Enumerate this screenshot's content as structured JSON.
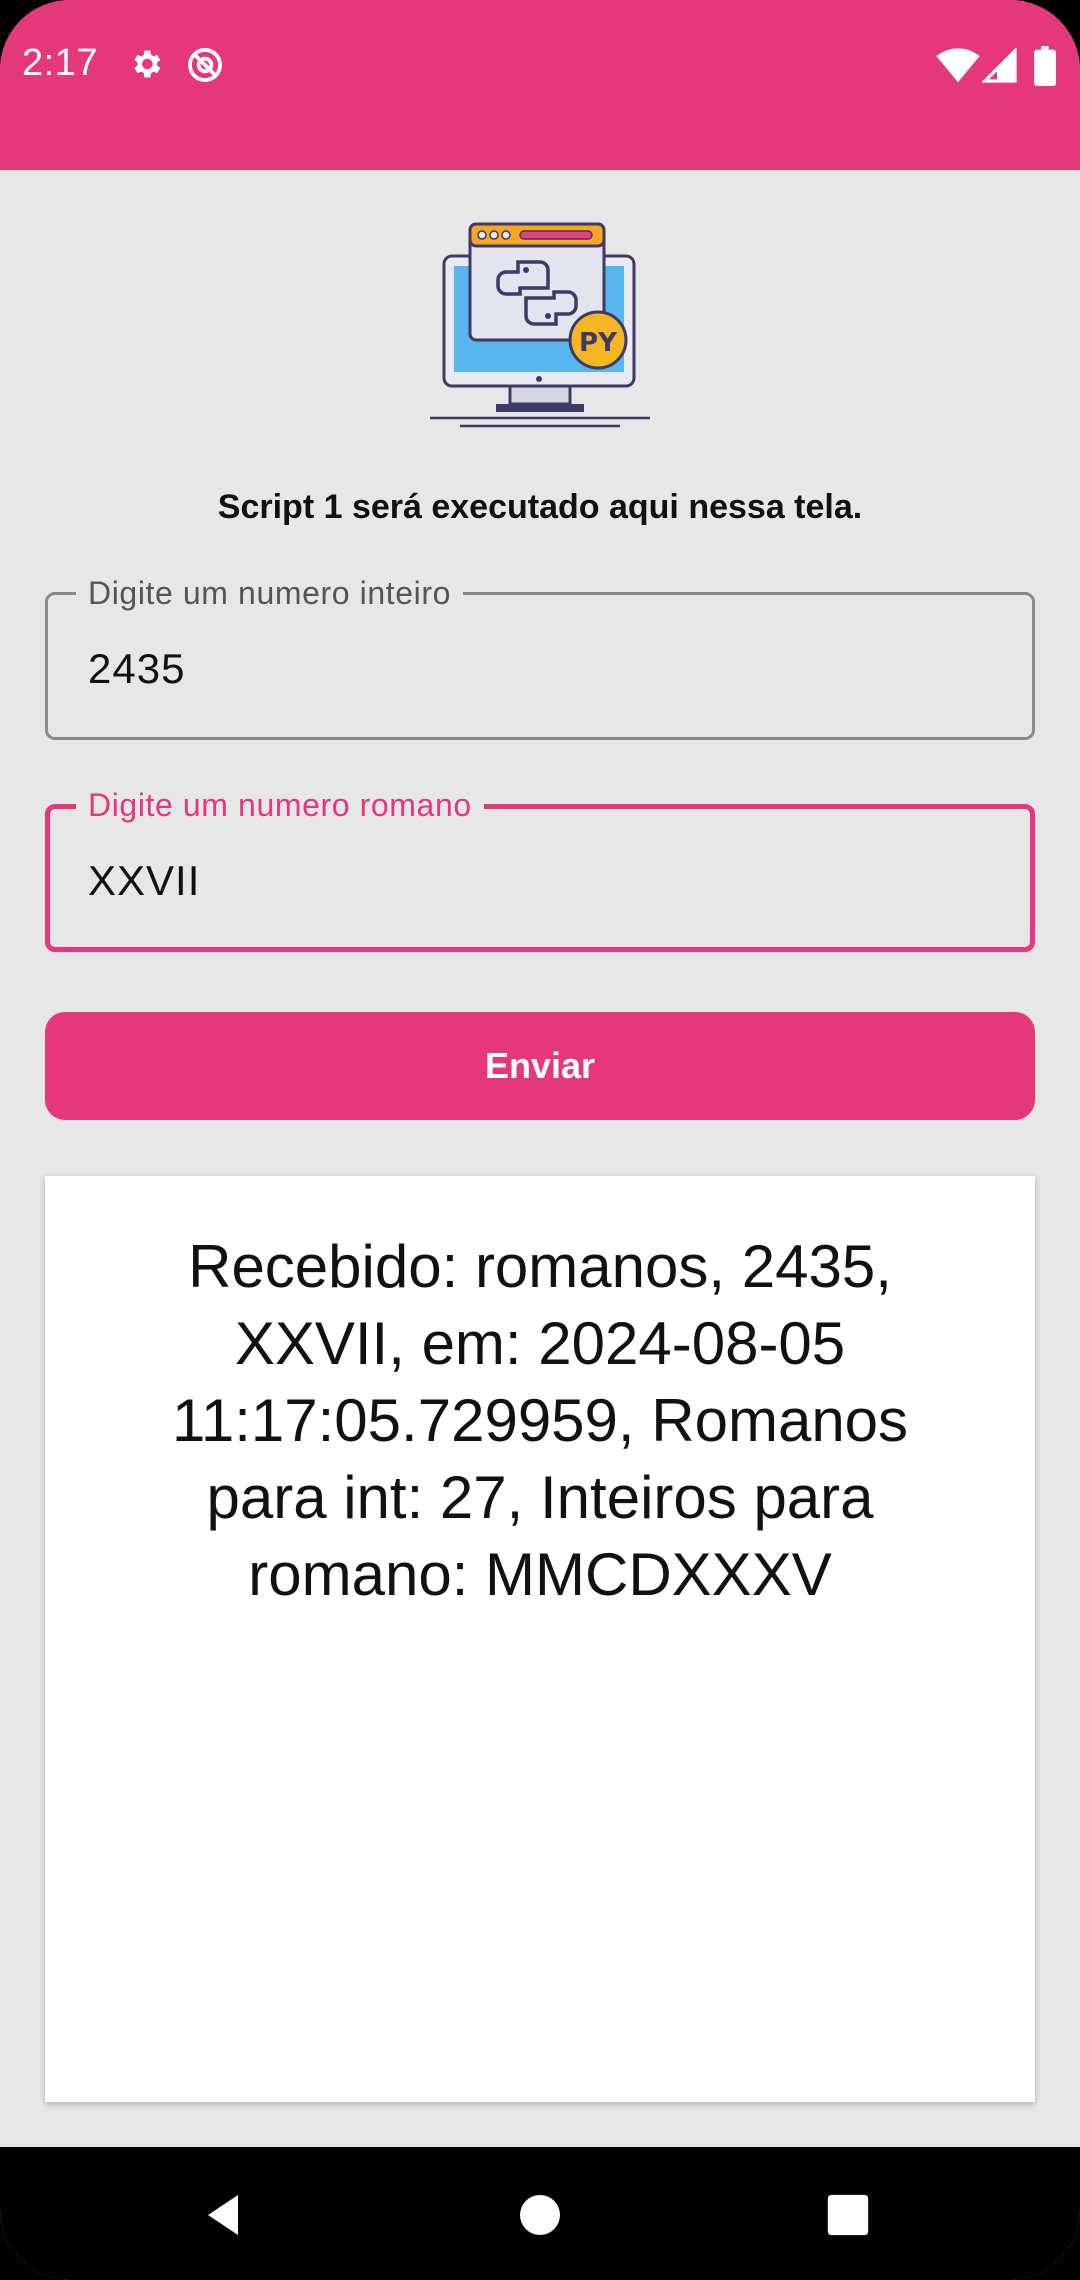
{
  "status_bar": {
    "time": "2:17",
    "left_icons": [
      "gear-icon",
      "no-disturb-icon"
    ],
    "right_icons": [
      "wifi-icon",
      "signal-icon",
      "battery-icon"
    ],
    "color": "#e5387a"
  },
  "main": {
    "illustration_badge": "PY",
    "headline": "Script 1 será executado aqui nessa tela.",
    "integer_field": {
      "label": "Digite um numero inteiro",
      "value": "2435"
    },
    "roman_field": {
      "label": "Digite um numero romano",
      "value": "XXVII"
    },
    "send_button_label": "Enviar",
    "result_text": "Recebido: romanos, 2435, XXVII, em: 2024-08-05 11:17:05.729959, Romanos para int: 27, Inteiros para romano: MMCDXXXV"
  },
  "nav_bar": {
    "buttons": [
      "back-icon",
      "home-icon",
      "recents-icon"
    ]
  },
  "colors": {
    "accent": "#e5387a",
    "background": "#e7e7e7",
    "card": "#ffffff"
  }
}
